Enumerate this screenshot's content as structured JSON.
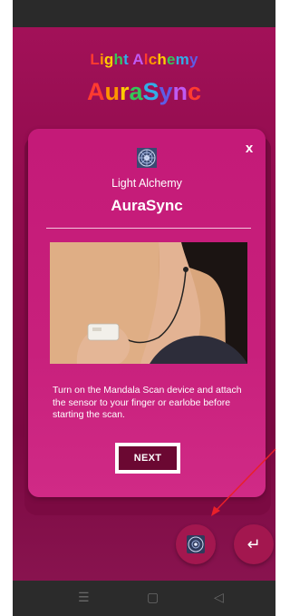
{
  "header": {
    "brand_small": "Light Alchemy",
    "brand_big": "AuraSync"
  },
  "modal": {
    "close_label": "x",
    "subtitle": "Light Alchemy",
    "title": "AuraSync",
    "instruction": "Turn on the Mandala Scan device and attach the sensor to your finger or earlobe before starting the scan.",
    "next_label": "NEXT"
  },
  "fabs": {
    "back_icon": "↵"
  },
  "navbar": {
    "menu_icon": "☰",
    "home_icon": "▢",
    "back_icon": "◁"
  },
  "colors": {
    "background": "#8e0b4c",
    "card": "#c8207c",
    "next_button": "#6b0832",
    "annotation_arrow": "#e8202a"
  },
  "icons": [
    "mandala-icon",
    "return-icon",
    "menu-icon",
    "home-icon",
    "back-triangle-icon"
  ]
}
